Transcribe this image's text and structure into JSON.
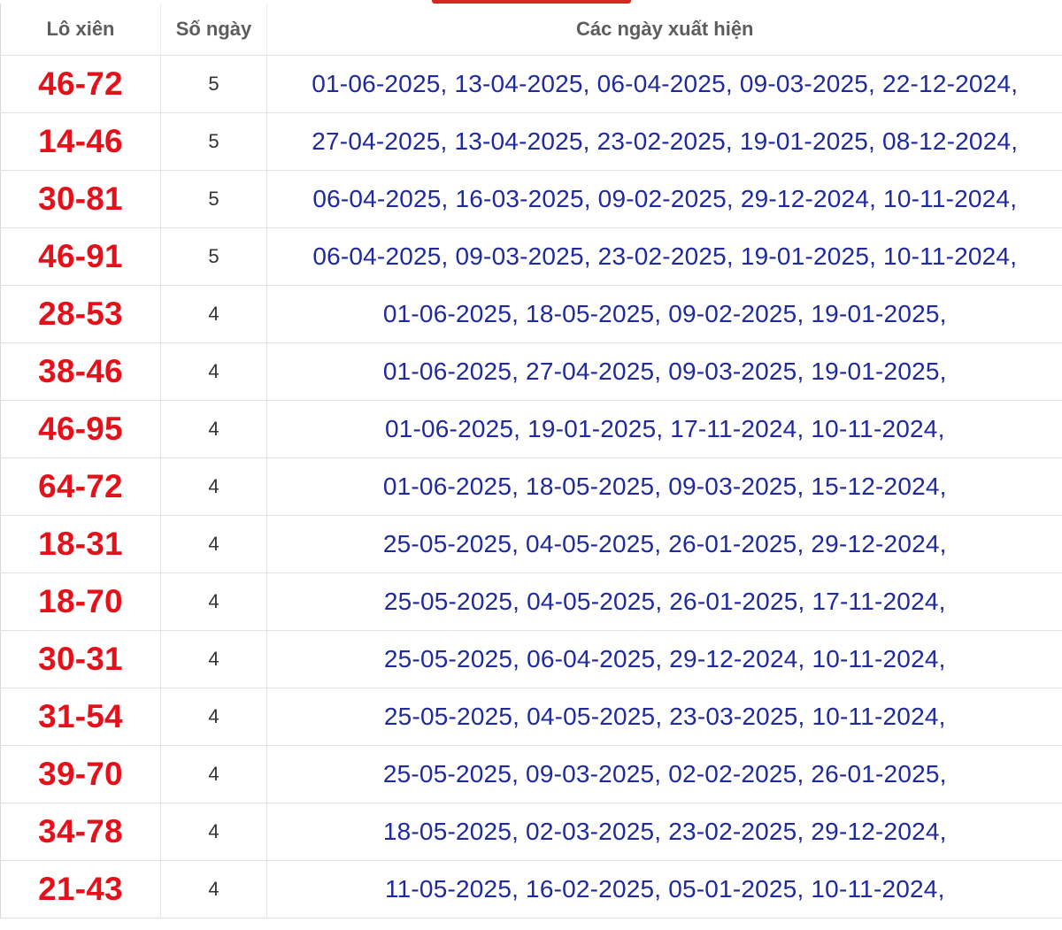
{
  "header": {
    "col_pair": "Lô xiên",
    "col_days": "Số ngày",
    "col_dates": "Các ngày xuất hiện"
  },
  "colors": {
    "pair": "#e5111a",
    "dates": "#1f2a9e",
    "tab_accent": "#d3271f"
  },
  "rows": [
    {
      "pair": "46-72",
      "days": "5",
      "dates": "01-06-2025, 13-04-2025, 06-04-2025, 09-03-2025, 22-12-2024,"
    },
    {
      "pair": "14-46",
      "days": "5",
      "dates": "27-04-2025, 13-04-2025, 23-02-2025, 19-01-2025, 08-12-2024,"
    },
    {
      "pair": "30-81",
      "days": "5",
      "dates": "06-04-2025, 16-03-2025, 09-02-2025, 29-12-2024, 10-11-2024,"
    },
    {
      "pair": "46-91",
      "days": "5",
      "dates": "06-04-2025, 09-03-2025, 23-02-2025, 19-01-2025, 10-11-2024,"
    },
    {
      "pair": "28-53",
      "days": "4",
      "dates": "01-06-2025, 18-05-2025, 09-02-2025, 19-01-2025,"
    },
    {
      "pair": "38-46",
      "days": "4",
      "dates": "01-06-2025, 27-04-2025, 09-03-2025, 19-01-2025,"
    },
    {
      "pair": "46-95",
      "days": "4",
      "dates": "01-06-2025, 19-01-2025, 17-11-2024, 10-11-2024,"
    },
    {
      "pair": "64-72",
      "days": "4",
      "dates": "01-06-2025, 18-05-2025, 09-03-2025, 15-12-2024,"
    },
    {
      "pair": "18-31",
      "days": "4",
      "dates": "25-05-2025, 04-05-2025, 26-01-2025, 29-12-2024,"
    },
    {
      "pair": "18-70",
      "days": "4",
      "dates": "25-05-2025, 04-05-2025, 26-01-2025, 17-11-2024,"
    },
    {
      "pair": "30-31",
      "days": "4",
      "dates": "25-05-2025, 06-04-2025, 29-12-2024, 10-11-2024,"
    },
    {
      "pair": "31-54",
      "days": "4",
      "dates": "25-05-2025, 04-05-2025, 23-03-2025, 10-11-2024,"
    },
    {
      "pair": "39-70",
      "days": "4",
      "dates": "25-05-2025, 09-03-2025, 02-02-2025, 26-01-2025,"
    },
    {
      "pair": "34-78",
      "days": "4",
      "dates": "18-05-2025, 02-03-2025, 23-02-2025, 29-12-2024,"
    },
    {
      "pair": "21-43",
      "days": "4",
      "dates": "11-05-2025, 16-02-2025, 05-01-2025, 10-11-2024,"
    }
  ]
}
